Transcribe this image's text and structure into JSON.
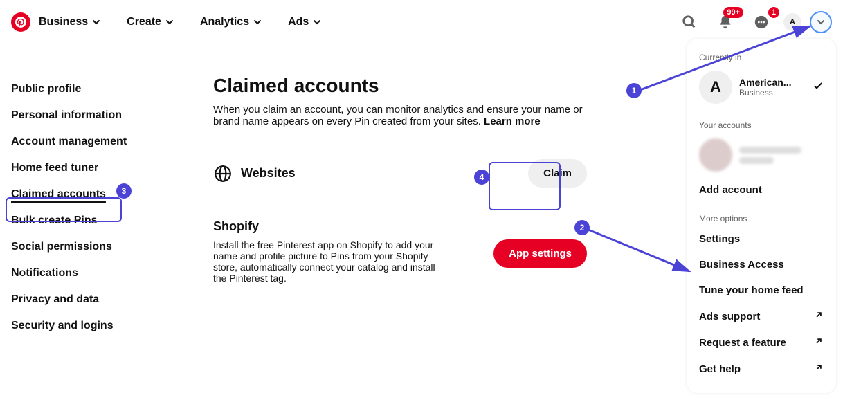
{
  "nav": {
    "items": [
      {
        "label": "Business"
      },
      {
        "label": "Create"
      },
      {
        "label": "Analytics"
      },
      {
        "label": "Ads"
      }
    ],
    "notif_badge": "99+",
    "msg_badge": "1",
    "avatar_letter": "A"
  },
  "sidebar": {
    "items": [
      {
        "label": "Public profile"
      },
      {
        "label": "Personal information"
      },
      {
        "label": "Account management"
      },
      {
        "label": "Home feed tuner"
      },
      {
        "label": "Claimed accounts"
      },
      {
        "label": "Bulk create Pins"
      },
      {
        "label": "Social permissions"
      },
      {
        "label": "Notifications"
      },
      {
        "label": "Privacy and data"
      },
      {
        "label": "Security and logins"
      }
    ]
  },
  "main": {
    "title": "Claimed accounts",
    "desc": "When you claim an account, you can monitor analytics and ensure your name or brand name appears on every Pin created from your sites. ",
    "learn_more": "Learn more",
    "websites_label": "Websites",
    "claim_btn": "Claim",
    "shopify_title": "Shopify",
    "shopify_desc": "Install the free Pinterest app on Shopify to add your name and profile picture to Pins from your Shopify store, automatically connect your catalog and install the Pinterest tag.",
    "app_settings_btn": "App settings"
  },
  "dropdown": {
    "currently_in": "Currently in",
    "account_name": "American...",
    "account_type": "Business",
    "account_letter": "A",
    "your_accounts": "Your accounts",
    "add_account": "Add account",
    "more_options": "More options",
    "items": [
      {
        "label": "Settings"
      },
      {
        "label": "Business Access"
      },
      {
        "label": "Tune your home feed"
      },
      {
        "label": "Ads support",
        "ext": true
      },
      {
        "label": "Request a feature",
        "ext": true
      },
      {
        "label": "Get help",
        "ext": true
      }
    ]
  },
  "annotations": {
    "a1": "1",
    "a2": "2",
    "a3": "3",
    "a4": "4"
  }
}
